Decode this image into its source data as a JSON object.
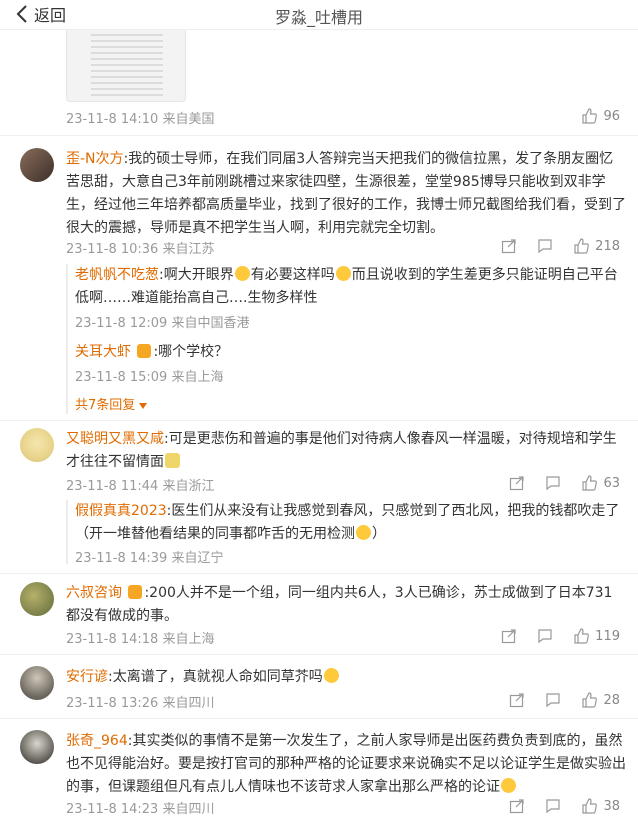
{
  "nav": {
    "back_label": "返回",
    "title": "罗淼_吐槽用"
  },
  "first": {
    "date": "23-11-8 14:10",
    "location": "来自美国",
    "likes": "96"
  },
  "comments": [
    {
      "user": "歪-N次方",
      "text": "我的硕士导师，在我们同届3人答辩完当天把我们的微信拉黑，发了条朋友圈忆苦思甜，大意自己3年前刚跳槽过来家徒四壁，生源很差，堂堂985博导只能收到双非学生，经过他三年培养都高质量毕业，找到了很好的工作，我博士师兄截图给我们看，受到了很大的震撼，导师是真不把学生当人啊，利用完就完全切割。",
      "date": "23-11-8 10:36",
      "location": "来自江苏",
      "likes": "218"
    },
    {
      "user": "又聪明又黑又咸",
      "text": "可是更悲伤和普遍的事是他们对待病人像春风一样温暖，对待规培和学生才往往不留情面",
      "date": "23-11-8 11:44",
      "location": "来自浙江",
      "likes": "63"
    },
    {
      "user": "六叔咨询",
      "text": "200人并不是一个组，同一组内共6人，3人已确诊，苏士成做到了日本731都没有做成的事。",
      "date": "23-11-8 14:18",
      "location": "来自上海",
      "likes": "119"
    },
    {
      "user": "安行谚",
      "text": "太离谱了，真就视人命如同草芥吗",
      "date": "23-11-8 13:26",
      "location": "来自四川",
      "likes": "28"
    },
    {
      "user": "张奇_964",
      "text": "其实类似的事情不是第一次发生了，之前人家导师是出医药费负责到底的，虽然也不见得能治好。要是按打官司的那种严格的论证要求来说确实不足以论证学生是做实验出的事，但课题组但凡有点儿人情味也不该苛求人家拿出那么严格的论证",
      "date": "23-11-8 14:23",
      "location": "来自四川",
      "likes": "38"
    }
  ],
  "replies": [
    {
      "user": "老帆帆不吃葱",
      "text": "啊大开眼界",
      "text2": "有必要这样吗",
      "text3": "而且说收到的学生差更多只能证明自己平台低啊……难道能抬高自己….生物多样性",
      "date": "23-11-8 12:09",
      "location": "来自中国香港"
    },
    {
      "user": "关耳大虾",
      "text": ":哪个学校？",
      "date": "23-11-8 15:09",
      "location": "来自上海"
    },
    {
      "user": "假假真真2023",
      "text": "医生们从来没有让我感觉到春风，只感觉到了西北风，把我的钱都吹走了（开一堆替他看结果的同事都咋舌的无用检测",
      "text2": "）",
      "date": "23-11-8 14:39",
      "location": "来自辽宁"
    }
  ],
  "more_replies": "共7条回复",
  "colors": {
    "accent": "#e06b00",
    "meta": "#9a9a9a"
  }
}
